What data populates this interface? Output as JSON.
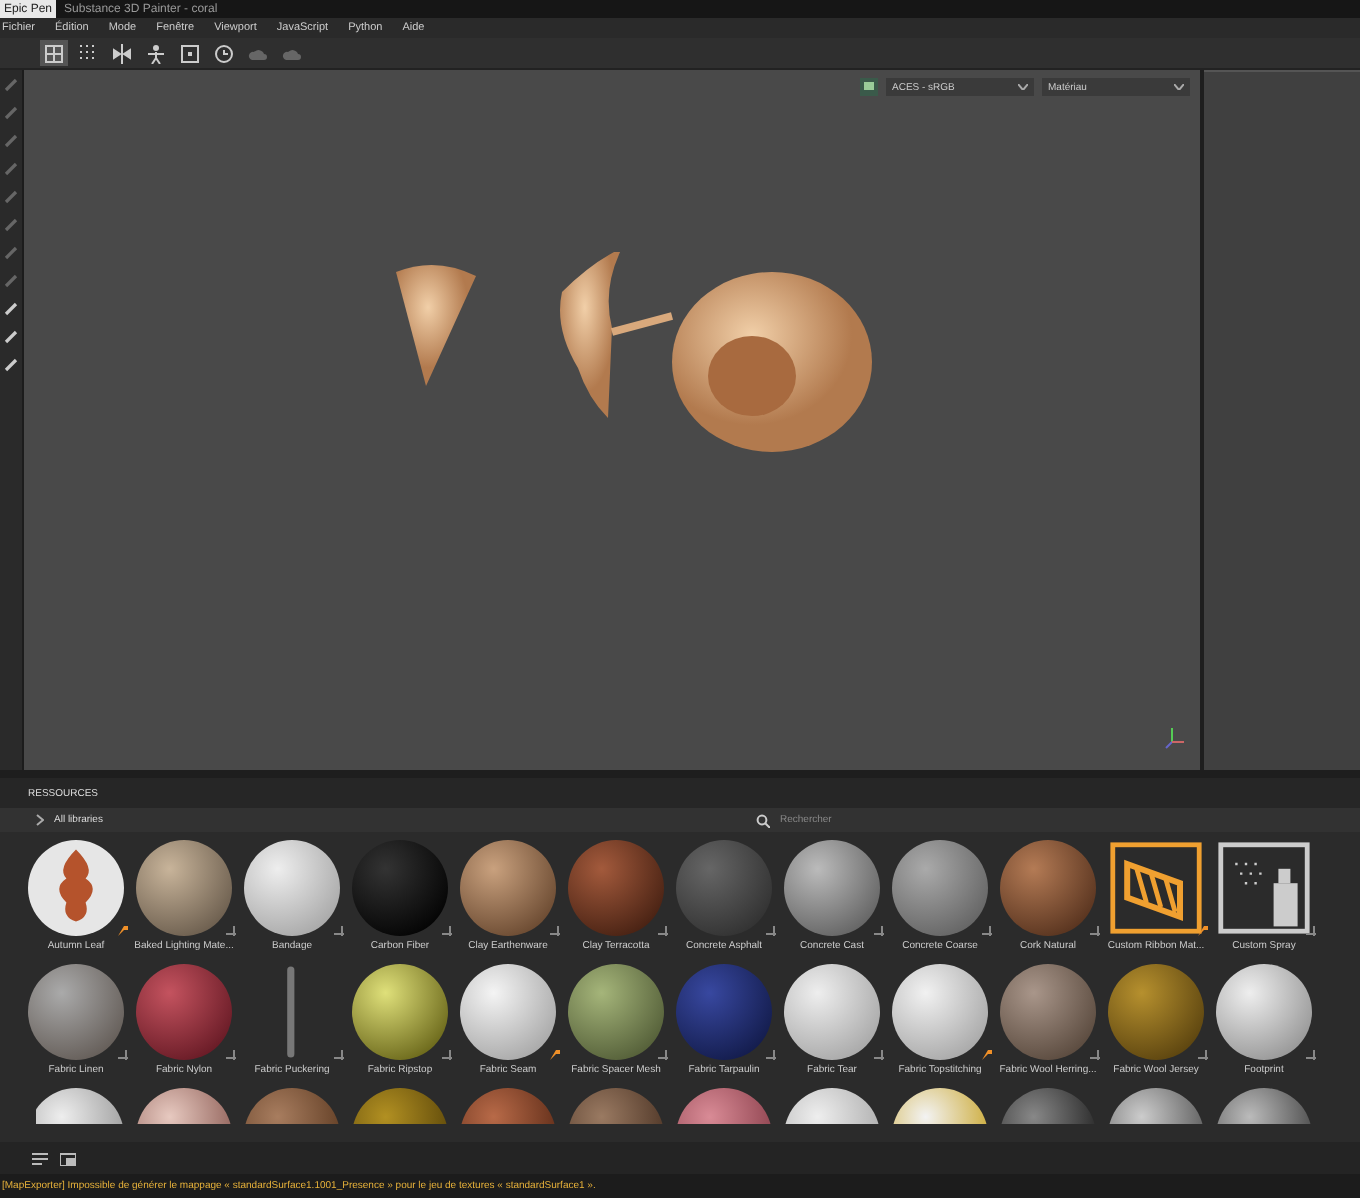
{
  "title_bar": {
    "tab": "Epic Pen",
    "title": "Substance 3D Painter - coral"
  },
  "menu": [
    "Fichier",
    "Édition",
    "Mode",
    "Fenêtre",
    "Viewport",
    "JavaScript",
    "Python",
    "Aide"
  ],
  "toolbar": [
    {
      "kind": "grid",
      "selected": true
    },
    {
      "kind": "dots",
      "selected": false
    },
    {
      "kind": "mirror",
      "selected": false
    },
    {
      "kind": "figure",
      "selected": false
    },
    {
      "kind": "frame",
      "selected": false
    },
    {
      "kind": "clock",
      "selected": false
    },
    {
      "kind": "cloud",
      "selected": false
    },
    {
      "kind": "cloud",
      "selected": false
    }
  ],
  "viewport": {
    "color_space": "ACES - sRGB",
    "display": "Matériau"
  },
  "resources": {
    "title": "RESSOURCES",
    "library": "All libraries",
    "search": {
      "placeholder": "Rechercher"
    },
    "rows": [
      {
        "items": [
          {
            "label": "Autumn Leaf",
            "kind": "leaf",
            "tagged": true
          },
          {
            "label": "Baked Lighting Mate...",
            "kind": "sphere",
            "tagged": false
          },
          {
            "label": "Bandage",
            "kind": "sphere",
            "tagged": false
          },
          {
            "label": "Carbon Fiber",
            "kind": "sphere",
            "tagged": false
          },
          {
            "label": "Clay Earthenware",
            "kind": "sphere",
            "tagged": false
          },
          {
            "label": "Clay Terracotta",
            "kind": "sphere",
            "tagged": false
          },
          {
            "label": "Concrete Asphalt",
            "kind": "sphere",
            "tagged": false
          },
          {
            "label": "Concrete Cast",
            "kind": "sphere",
            "tagged": false
          },
          {
            "label": "Concrete Coarse",
            "kind": "sphere",
            "tagged": false
          },
          {
            "label": "Cork Natural",
            "kind": "sphere",
            "tagged": false
          },
          {
            "label": "Custom Ribbon Mat...",
            "kind": "ribbon",
            "tagged": true
          },
          {
            "label": "Custom Spray",
            "kind": "spray",
            "tagged": false
          }
        ]
      },
      {
        "items": [
          {
            "label": "Fabric Linen",
            "kind": "sphere",
            "tagged": false
          },
          {
            "label": "Fabric Nylon",
            "kind": "sphere",
            "tagged": false
          },
          {
            "label": "Fabric Puckering",
            "kind": "strip",
            "tagged": false
          },
          {
            "label": "Fabric Ripstop",
            "kind": "sphere",
            "tagged": false
          },
          {
            "label": "Fabric Seam",
            "kind": "sphere",
            "tagged": true
          },
          {
            "label": "Fabric Spacer Mesh",
            "kind": "sphere",
            "tagged": false
          },
          {
            "label": "Fabric Tarpaulin",
            "kind": "sphere",
            "tagged": false
          },
          {
            "label": "Fabric Tear",
            "kind": "sphere",
            "tagged": false
          },
          {
            "label": "Fabric Topstitching",
            "kind": "sphere",
            "tagged": true
          },
          {
            "label": "Fabric Wool Herring...",
            "kind": "sphere",
            "tagged": false
          },
          {
            "label": "Fabric Wool Jersey",
            "kind": "sphere",
            "tagged": false
          },
          {
            "label": "Footprint",
            "kind": "sphere",
            "tagged": false
          }
        ]
      },
      {
        "items": [
          {
            "kind": "sphere"
          },
          {
            "kind": "sphere"
          },
          {
            "kind": "sphere"
          },
          {
            "kind": "sphere"
          },
          {
            "kind": "sphere"
          },
          {
            "kind": "sphere"
          },
          {
            "kind": "sphere"
          },
          {
            "kind": "sphere"
          },
          {
            "kind": "sphere"
          },
          {
            "kind": "sphere"
          },
          {
            "kind": "sphere"
          },
          {
            "kind": "sphere"
          }
        ]
      }
    ]
  },
  "status": "[MapExporter] Impossible de générer le mappage « standardSurface1.1001_Presence » pour le jeu de textures « standardSurface1 »."
}
